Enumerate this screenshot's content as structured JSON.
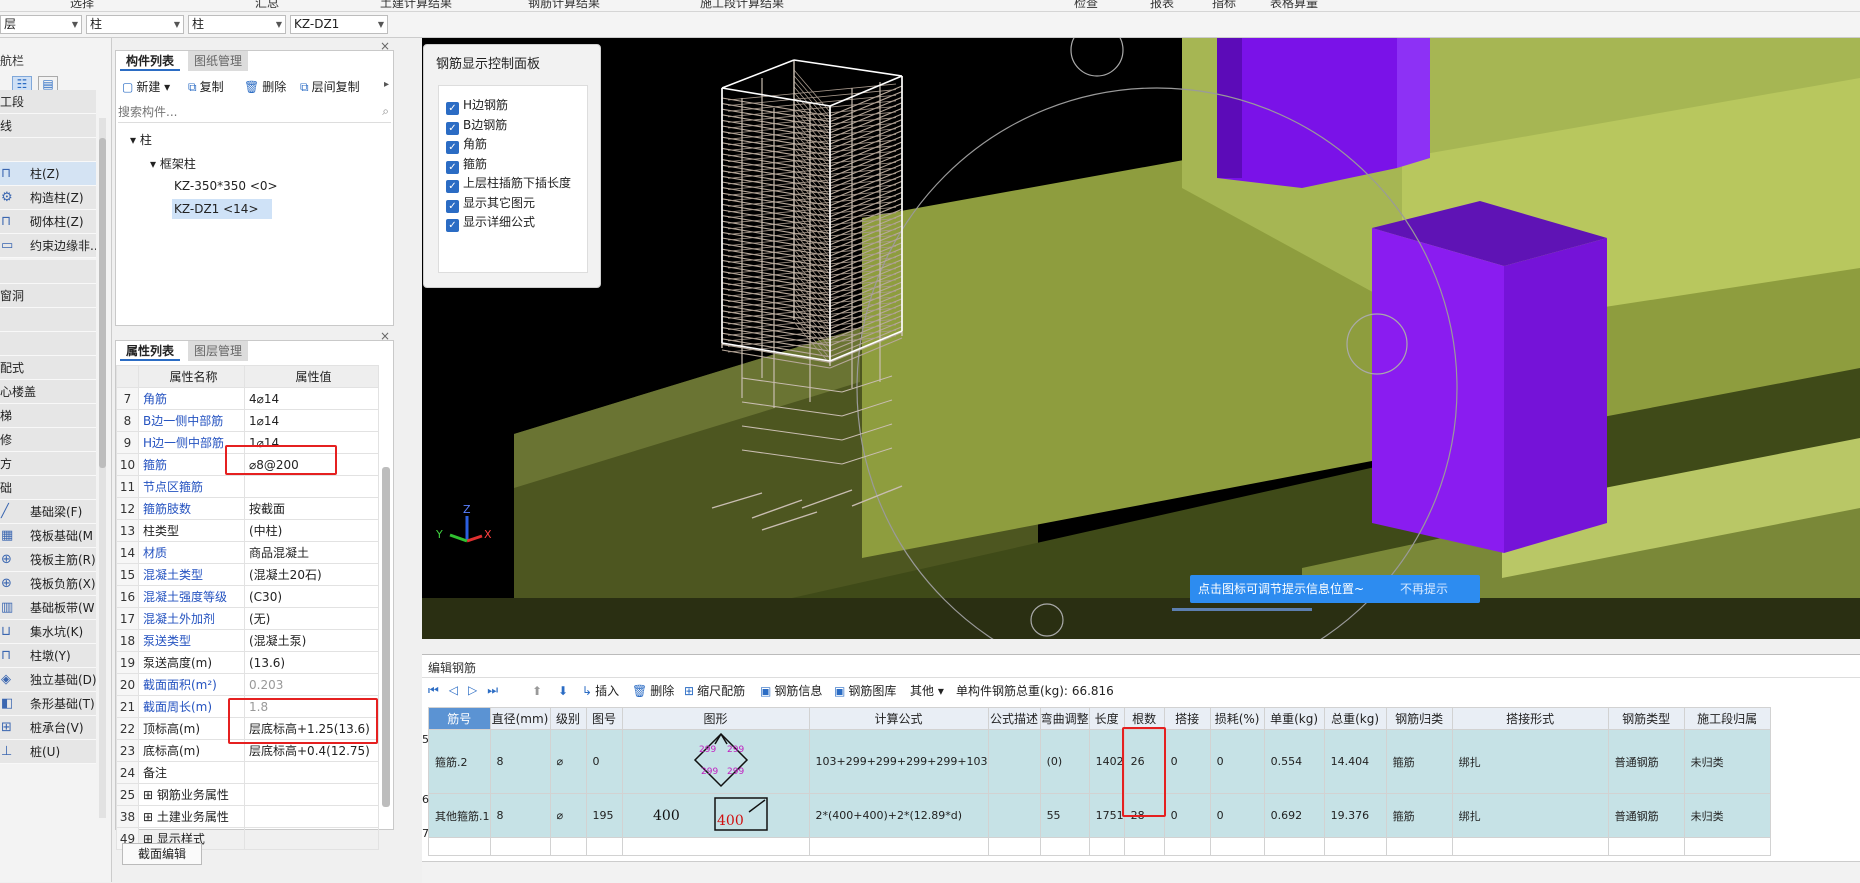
{
  "topbar": {
    "items": [
      "选择",
      "汇总",
      "土建计算结果",
      "钢筋计算结果",
      "施工段计算结果",
      "检查",
      "报表",
      "指标",
      "表格算量"
    ]
  },
  "filters": {
    "floor": "层",
    "type": "柱",
    "subtype": "柱",
    "component": "KZ-DZ1"
  },
  "nav": {
    "title": "航栏",
    "items": [
      {
        "label": "工段",
        "icon": ""
      },
      {
        "label": "线",
        "icon": ""
      },
      {
        "label": "",
        "icon": ""
      },
      {
        "label": "柱(Z)",
        "icon": "column-icon",
        "sel": true
      },
      {
        "label": "构造柱(Z)",
        "icon": "construct-column-icon"
      },
      {
        "label": "砌体柱(Z)",
        "icon": "masonry-column-icon"
      },
      {
        "label": "约束边缘非...",
        "icon": "edge-icon"
      },
      {
        "label": "",
        "icon": ""
      },
      {
        "label": "窗洞",
        "icon": ""
      },
      {
        "label": "",
        "icon": ""
      },
      {
        "label": "",
        "icon": ""
      },
      {
        "label": "配式",
        "icon": ""
      },
      {
        "label": "心楼盖",
        "icon": ""
      },
      {
        "label": "梯",
        "icon": ""
      },
      {
        "label": "修",
        "icon": ""
      },
      {
        "label": "方",
        "icon": ""
      },
      {
        "label": "础",
        "icon": ""
      },
      {
        "label": "基础梁(F)",
        "icon": "beam-icon"
      },
      {
        "label": "筏板基础(M",
        "icon": "raft-icon"
      },
      {
        "label": "筏板主筋(R)",
        "icon": "rebar-icon"
      },
      {
        "label": "筏板负筋(X)",
        "icon": "rebar-icon"
      },
      {
        "label": "基础板带(W",
        "icon": "strip-icon"
      },
      {
        "label": "集水坑(K)",
        "icon": "pit-icon"
      },
      {
        "label": "柱墩(Y)",
        "icon": "pier-icon"
      },
      {
        "label": "独立基础(D)",
        "icon": "foundation-icon"
      },
      {
        "label": "条形基础(T)",
        "icon": "strip-foundation-icon"
      },
      {
        "label": "桩承台(V)",
        "icon": "cap-icon"
      },
      {
        "label": "桩(U)",
        "icon": "pile-icon"
      }
    ]
  },
  "complist": {
    "tabs": [
      "构件列表",
      "图纸管理"
    ],
    "toolbar": {
      "new": "新建",
      "copy": "复制",
      "delete": "删除",
      "floor_copy": "层间复制"
    },
    "search_placeholder": "搜索构件...",
    "tree": {
      "root": "柱",
      "group": "框架柱",
      "items": [
        "KZ-350*350 <0>",
        "KZ-DZ1 <14>"
      ]
    }
  },
  "props": {
    "tabs": [
      "属性列表",
      "图层管理"
    ],
    "header": {
      "name": "属性名称",
      "value": "属性值"
    },
    "rows": [
      {
        "n": "7",
        "k": "角筋",
        "v": "4⌀14",
        "blue": true
      },
      {
        "n": "8",
        "k": "B边一侧中部筋",
        "v": "1⌀14",
        "blue": true
      },
      {
        "n": "9",
        "k": "H边一侧中部筋",
        "v": "1⌀14",
        "blue": true
      },
      {
        "n": "10",
        "k": "箍筋",
        "v": "⌀8@200",
        "blue": true
      },
      {
        "n": "11",
        "k": "节点区箍筋",
        "v": "",
        "blue": true
      },
      {
        "n": "12",
        "k": "箍筋肢数",
        "v": "按截面",
        "blue": true
      },
      {
        "n": "13",
        "k": "柱类型",
        "v": "(中柱)",
        "blue": false
      },
      {
        "n": "14",
        "k": "材质",
        "v": "商品混凝土",
        "blue": true
      },
      {
        "n": "15",
        "k": "混凝土类型",
        "v": "(混凝土20石)",
        "blue": true
      },
      {
        "n": "16",
        "k": "混凝土强度等级",
        "v": "(C30)",
        "blue": true
      },
      {
        "n": "17",
        "k": "混凝土外加剂",
        "v": "(无)",
        "blue": true
      },
      {
        "n": "18",
        "k": "泵送类型",
        "v": "(混凝土泵)",
        "blue": true
      },
      {
        "n": "19",
        "k": "泵送高度(m)",
        "v": "(13.6)",
        "blue": false
      },
      {
        "n": "20",
        "k": "截面面积(m²)",
        "v": "0.203",
        "blue": true,
        "gray": true
      },
      {
        "n": "21",
        "k": "截面周长(m)",
        "v": "1.8",
        "blue": true,
        "gray": true
      },
      {
        "n": "22",
        "k": "顶标高(m)",
        "v": "层底标高+1.25(13.6)",
        "blue": false
      },
      {
        "n": "23",
        "k": "底标高(m)",
        "v": "层底标高+0.4(12.75)",
        "blue": false
      },
      {
        "n": "24",
        "k": "备注",
        "v": "",
        "blue": false
      },
      {
        "n": "25",
        "k": "⊞ 钢筋业务属性",
        "v": "",
        "blue": false
      },
      {
        "n": "38",
        "k": "⊞ 土建业务属性",
        "v": "",
        "blue": false
      },
      {
        "n": "49",
        "k": "⊞ 显示样式",
        "v": "",
        "blue": false
      }
    ],
    "section_button": "截面编辑"
  },
  "ctrl": {
    "title": "钢筋显示控制面板",
    "options": [
      "H边钢筋",
      "B边钢筋",
      "角筋",
      "箍筋",
      "上层柱插筋下插长度",
      "显示其它图元",
      "显示详细公式"
    ]
  },
  "tip": {
    "text": "点击图标可调节提示信息位置~",
    "dismiss": "不再提示"
  },
  "axis": {
    "x": "X",
    "y": "Y",
    "z": "Z"
  },
  "rebar": {
    "title": "编辑钢筋",
    "toolbar": {
      "insert": "插入",
      "delete": "删除",
      "scale": "缩尺配筋",
      "info": "钢筋信息",
      "library": "钢筋图库",
      "other": "其他",
      "total_label": "单构件钢筋总重(kg):",
      "total": "66.816"
    },
    "headers": [
      "筋号",
      "直径(mm)",
      "级别",
      "图号",
      "图形",
      "计算公式",
      "公式描述",
      "弯曲调整",
      "长度",
      "根数",
      "搭接",
      "损耗(%)",
      "单重(kg)",
      "总重(kg)",
      "钢筋归类",
      "搭接形式",
      "钢筋类型",
      "施工段归属"
    ],
    "rows": [
      {
        "idx": "5",
        "name": "箍筋.2",
        "dia": "8",
        "grade": "⌀",
        "fig": "0",
        "formula": "103+299+299+299+299+103",
        "desc": "",
        "bend": "(0)",
        "len": "1402",
        "count": "26",
        "lap": "0",
        "loss": "0",
        "unit": "0.554",
        "total": "14.404",
        "cat": "箍筋",
        "form": "绑扎",
        "type": "普通钢筋",
        "seg": "未归类"
      },
      {
        "idx": "6",
        "name": "其他箍筋.1",
        "dia": "8",
        "grade": "⌀",
        "fig": "195",
        "formula": "2*(400+400)+2*(12.89*d)",
        "desc": "",
        "bend": "55",
        "len": "1751",
        "count": "28",
        "lap": "0",
        "loss": "0",
        "unit": "0.692",
        "total": "19.376",
        "cat": "箍筋",
        "form": "绑扎",
        "type": "普通钢筋",
        "seg": "未归类"
      }
    ],
    "empty_idx": "7",
    "shape1": {
      "dims": [
        "299",
        "299",
        "299",
        "299"
      ]
    },
    "shape2": {
      "left": "400",
      "box": "400"
    }
  },
  "colors": {
    "accent": "#2b6cc4",
    "purple": "#8a1cf0",
    "green": "#a7b550",
    "highlight": "#e52020"
  }
}
